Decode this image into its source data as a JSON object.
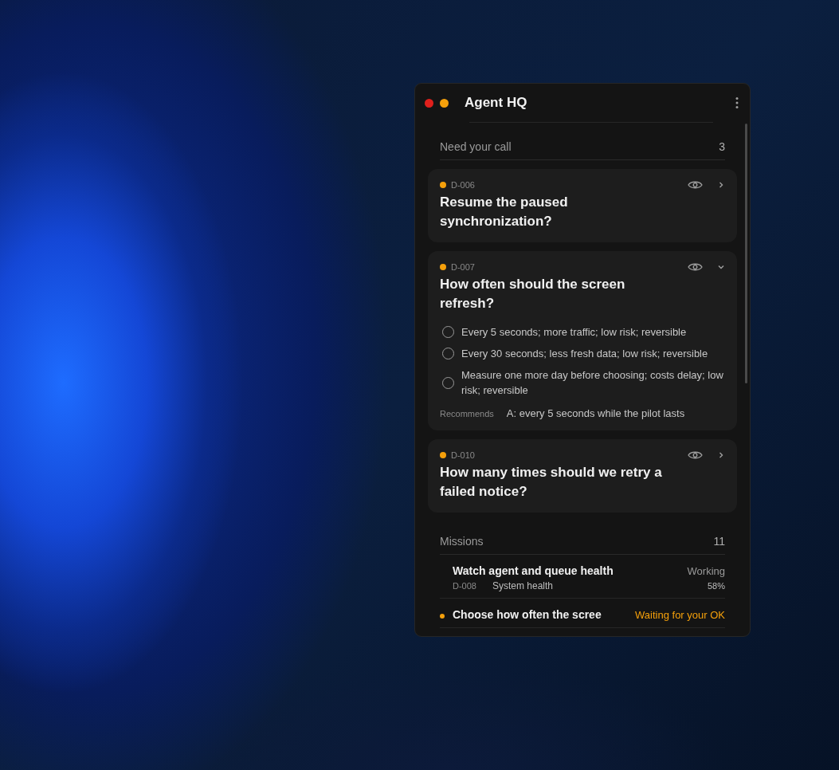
{
  "window": {
    "title": "Agent HQ"
  },
  "decisions": {
    "title": "Need your call",
    "count": "3",
    "items": [
      {
        "id": "D-006",
        "color": "#f5a00b",
        "title": "Resume the paused synchronization?",
        "expanded": false
      },
      {
        "id": "D-007",
        "color": "#f5a00b",
        "title": "How often should the screen refresh?",
        "expanded": true,
        "options": [
          {
            "label": "Every 5 seconds; more traffic; low risk; reversible",
            "selected": false
          },
          {
            "label": "Every 30 seconds; less fresh data; low risk; reversible",
            "selected": false
          },
          {
            "label": "Measure one more day before choosing; costs delay; low risk; reversible",
            "selected": false
          }
        ],
        "recommends_label": "Recommends",
        "recommends": "A: every 5 seconds while the pilot lasts"
      },
      {
        "id": "D-010",
        "color": "#f5a00b",
        "title": "How many times should we retry a failed notice?",
        "expanded": false
      }
    ]
  },
  "missions": {
    "title": "Missions",
    "count": "11",
    "items": [
      {
        "title": "Watch agent and queue health",
        "status": "Working",
        "id": "D-008",
        "category": "System health",
        "progress": "58%",
        "attention": false
      },
      {
        "title": "Choose how often the scree",
        "status": "Waiting for your OK",
        "attention": true
      }
    ]
  }
}
